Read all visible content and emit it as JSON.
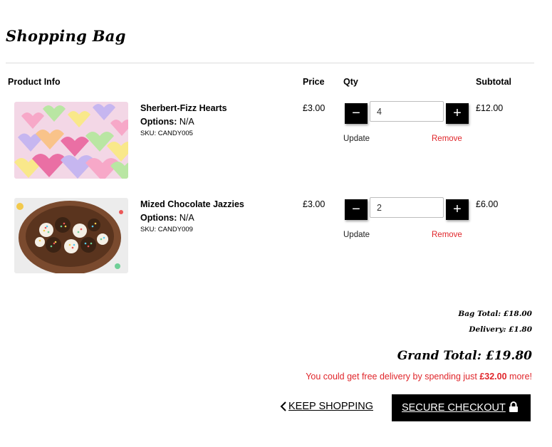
{
  "page": {
    "title": "Shopping Bag"
  },
  "table": {
    "headers": {
      "product": "Product Info",
      "price": "Price",
      "qty": "Qty",
      "subtotal": "Subtotal"
    }
  },
  "items": [
    {
      "name": "Sherbert-Fizz Hearts",
      "options_label": "Options:",
      "options_value": "N/A",
      "sku": "SKU: CANDY005",
      "price": "£3.00",
      "qty": "4",
      "subtotal": "£12.00",
      "minus": "−",
      "plus": "+",
      "update_label": "Update",
      "remove_label": "Remove"
    },
    {
      "name": "Mized Chocolate Jazzies",
      "options_label": "Options:",
      "options_value": "N/A",
      "sku": "SKU: CANDY009",
      "price": "£3.00",
      "qty": "2",
      "subtotal": "£6.00",
      "minus": "−",
      "plus": "+",
      "update_label": "Update",
      "remove_label": "Remove"
    }
  ],
  "totals": {
    "bag_total": "Bag Total: £18.00",
    "delivery": "Delivery: £1.80",
    "grand_total": "Grand Total: £19.80",
    "free_pre": "You could get free delivery by spending just ",
    "free_amount": "£32.00",
    "free_post": " more!"
  },
  "actions": {
    "keep_shopping": "KEEP SHOPPING",
    "checkout": "SECURE CHECKOUT"
  },
  "colors": {
    "accent_red": "#e0262b",
    "button_black": "#000000"
  },
  "icons": {
    "back": "chevron-left-icon",
    "lock": "lock-icon"
  }
}
